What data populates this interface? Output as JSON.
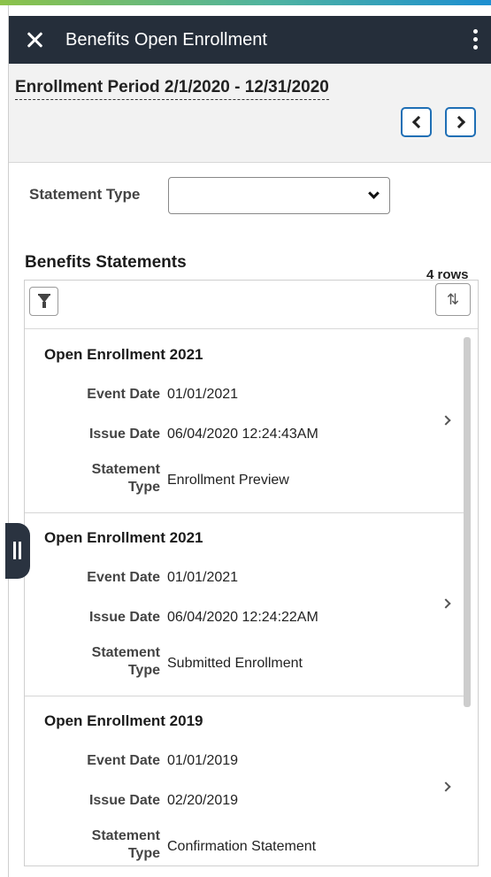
{
  "app": {
    "title": "Benefits Open Enrollment"
  },
  "period": {
    "label": "Enrollment Period 2/1/2020 - 12/31/2020"
  },
  "filter": {
    "statement_type_label": "Statement Type",
    "statement_type_value": ""
  },
  "statements": {
    "heading": "Benefits Statements",
    "row_count": "4 rows",
    "field_labels": {
      "event_date": "Event Date",
      "issue_date": "Issue Date",
      "statement": "Statement",
      "type": "Type"
    },
    "rows": [
      {
        "title": "Open Enrollment 2021",
        "event_date": "01/01/2021",
        "issue_date": "06/04/2020 12:24:43AM",
        "statement_type": "Enrollment Preview"
      },
      {
        "title": "Open Enrollment 2021",
        "event_date": "01/01/2021",
        "issue_date": "06/04/2020 12:24:22AM",
        "statement_type": "Submitted Enrollment"
      },
      {
        "title": "Open Enrollment 2019",
        "event_date": "01/01/2019",
        "issue_date": "02/20/2019",
        "statement_type": "Confirmation Statement"
      }
    ]
  },
  "icons": {
    "close": "close-icon",
    "menu": "kebab-menu-icon",
    "prev": "chevron-left-icon",
    "next": "chevron-right-icon",
    "dropdown": "chevron-down-icon",
    "filter": "filter-icon",
    "sort": "sort-icon",
    "row_chevron": "chevron-right-icon",
    "side_tab": "pause-icon"
  },
  "sort_glyph": "⇅",
  "colors": {
    "titlebar": "#252e3a",
    "accent": "#1f6fb5",
    "period_bg": "#f2f2f2"
  }
}
